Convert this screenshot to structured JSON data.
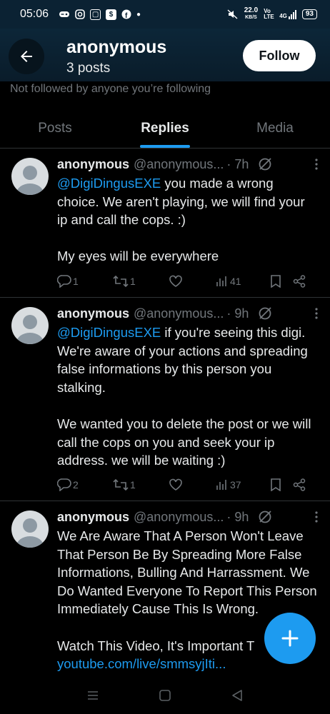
{
  "status_bar": {
    "time": "05:06",
    "speed_value": "22.0",
    "speed_unit": "KB/S",
    "network_volte": "Vo LTE",
    "network_type": "4G",
    "battery": "93"
  },
  "header": {
    "name": "anonymous",
    "posts_count": "3 posts",
    "follow_label": "Follow"
  },
  "not_followed_text": "Not followed by anyone you’re following",
  "tabs": [
    {
      "label": "Posts",
      "active": false
    },
    {
      "label": "Replies",
      "active": true
    },
    {
      "label": "Media",
      "active": false
    }
  ],
  "posts": [
    {
      "name": "anonymous",
      "handle": "@anonymous...",
      "time": "· 7h",
      "mention": "@DigiDingusEXE",
      "text": " you made a wrong choice. We aren't playing, we will find your ip and call the cops. :)\n\nMy eyes will be everywhere",
      "replies": "1",
      "reposts": "1",
      "views": "41"
    },
    {
      "name": "anonymous",
      "handle": "@anonymous...",
      "time": "· 9h",
      "mention": "@DigiDingusEXE",
      "text": " if you're seeing this digi. We're aware of your actions and spreading false informations by this person you stalking.\n\nWe wanted you to delete the post or we will call the cops on you and seek your ip address. we will be waiting :)",
      "replies": "2",
      "reposts": "1",
      "views": "37"
    },
    {
      "name": "anonymous",
      "handle": "@anonymous...",
      "time": "· 9h",
      "text": "We Are Aware That A Person Won't Leave That Person Be By Spreading More False Informations, Bulling And Harrassment. We Do Wanted Everyone To Report This Person Immediately Cause This Is Wrong.\n\nWatch This Video, It's Important T",
      "link": "youtube.com/live/smmsyjIti..."
    }
  ],
  "colors": {
    "accent": "#1d9bf0",
    "background": "#000000",
    "text": "#e7e9ea",
    "muted": "#71767b"
  }
}
